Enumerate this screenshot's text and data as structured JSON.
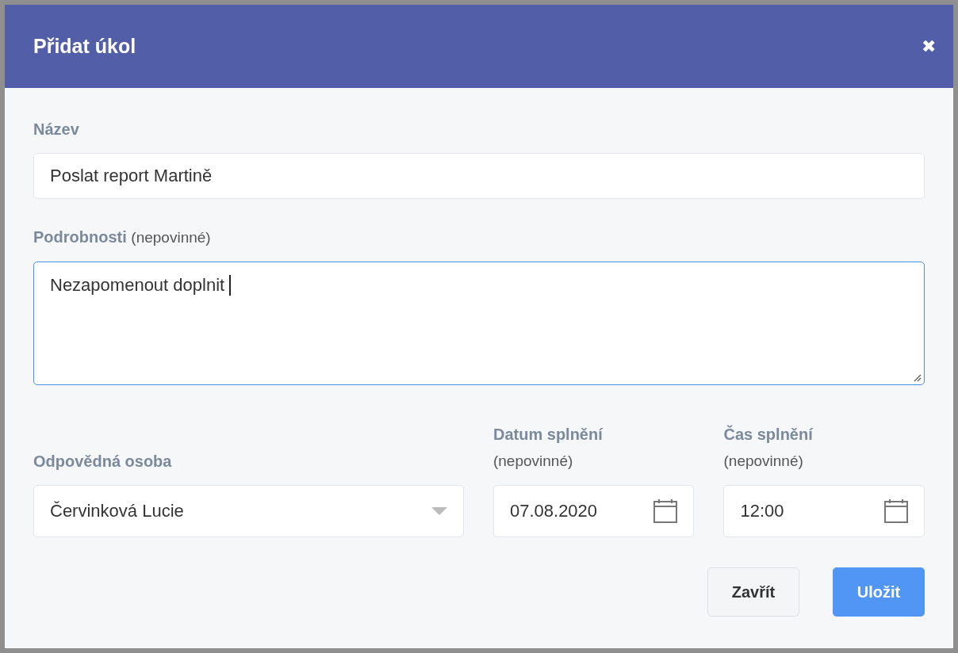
{
  "dialog": {
    "title": "Přidat úkol",
    "close": "✖"
  },
  "fields": [
    {
      "kind": "input",
      "label": "Název",
      "value": "Poslat report Martině",
      "focused": false
    },
    {
      "kind": "textarea",
      "label": "Podrobnosti",
      "hint": "(nepovinné)",
      "value": "Nezapomenout doplnit",
      "focused": true
    }
  ],
  "row": [
    {
      "kind": "select",
      "label": "Odpovědná osoba",
      "value": "Červinková Lucie"
    },
    {
      "kind": "date",
      "label": "Datum splnění",
      "hint": "(nepovinné)",
      "value": "07.08.2020"
    },
    {
      "kind": "date",
      "label": "Čas splnění",
      "hint": "(nepovinné)",
      "value": "12:00"
    }
  ],
  "buttons": [
    {
      "label": "Zavřít",
      "primary": false
    },
    {
      "label": "Uložit",
      "primary": true
    }
  ]
}
